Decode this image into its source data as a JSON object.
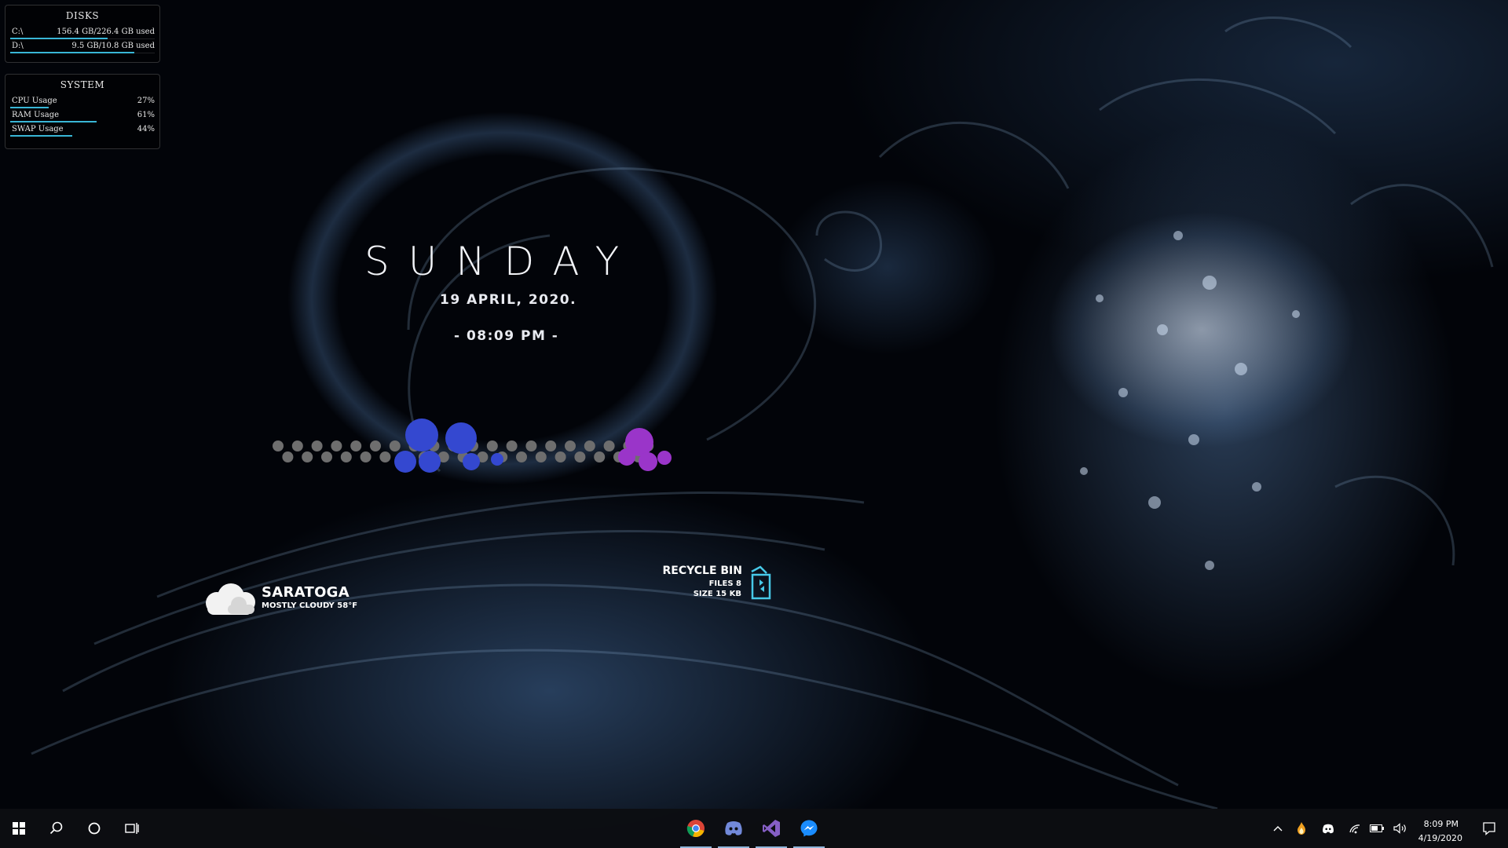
{
  "disks": {
    "title": "DISKS",
    "items": [
      {
        "label": "C:\\",
        "value": "156.4 GB/226.4 GB used",
        "fraction": 0.69
      },
      {
        "label": "D:\\",
        "value": "9.5 GB/10.8 GB used",
        "fraction": 0.88
      }
    ]
  },
  "system": {
    "title": "SYSTEM",
    "items": [
      {
        "label": "CPU Usage",
        "value": "27%",
        "fraction": 0.27
      },
      {
        "label": "RAM Usage",
        "value": "61%",
        "fraction": 0.61
      },
      {
        "label": "SWAP Usage",
        "value": "44%",
        "fraction": 0.44
      }
    ]
  },
  "clock": {
    "day": "SUNDAY",
    "date": "19 APRIL, 2020.",
    "time": "- 08:09 PM -"
  },
  "visualizer": {
    "colors": {
      "idle": "#6e6e6e",
      "blue": "#3448d0",
      "violet": "#9a35c9"
    }
  },
  "weather": {
    "city": "SARATOGA",
    "condition": "MOSTLY CLOUDY 58°F",
    "icon": "cloud-icon"
  },
  "recycle_bin": {
    "title": "RECYCLE BIN",
    "files": "FILES 8",
    "size": "SIZE 15 KB",
    "icon": "recycle-bin-icon",
    "color": "#47c9e8"
  },
  "taskbar": {
    "left": [
      "windows-start-icon",
      "search-icon",
      "cortana-icon",
      "task-view-icon"
    ],
    "apps": [
      "chrome-icon",
      "discord-icon",
      "visual-studio-icon",
      "messenger-icon"
    ],
    "tray": [
      "chevron-up-icon",
      "flame-icon",
      "discord-tray-icon",
      "wifi-icon",
      "battery-icon",
      "volume-icon"
    ],
    "time": "8:09 PM",
    "date": "4/19/2020",
    "notification_icon": "notification-icon"
  }
}
